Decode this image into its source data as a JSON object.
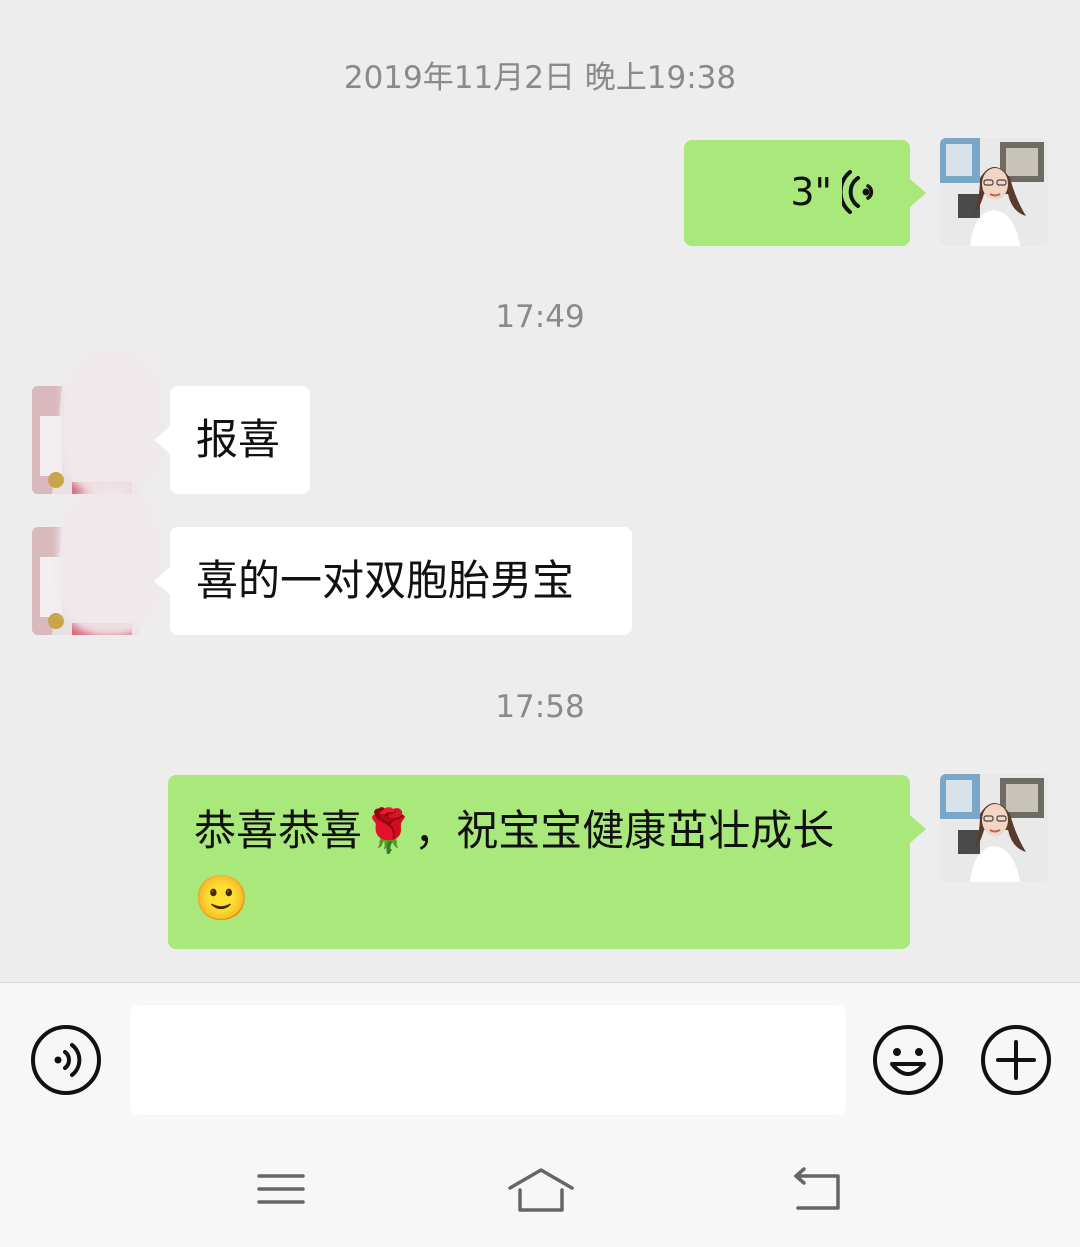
{
  "messages": {
    "timestamp_1": "2019年11月2日 晚上19:38",
    "voice_duration": "3\"",
    "timestamp_2": "17:49",
    "received_1": "报喜",
    "received_2": "喜的一对双胞胎男宝",
    "timestamp_3": "17:58",
    "sent_text_line1": "恭喜恭喜🌹，祝宝宝健康茁壮成长",
    "sent_text_emoji": "🙂"
  },
  "input_bar": {
    "placeholder": ""
  },
  "icons": {
    "voice_toggle": "voice-icon",
    "emoji": "emoji-icon",
    "more": "plus-icon",
    "nav_menu": "menu-icon",
    "nav_home": "home-icon",
    "nav_back": "back-icon"
  },
  "colors": {
    "sent_bubble": "#a9e87a",
    "received_bubble": "#ffffff",
    "background": "#ededed"
  }
}
